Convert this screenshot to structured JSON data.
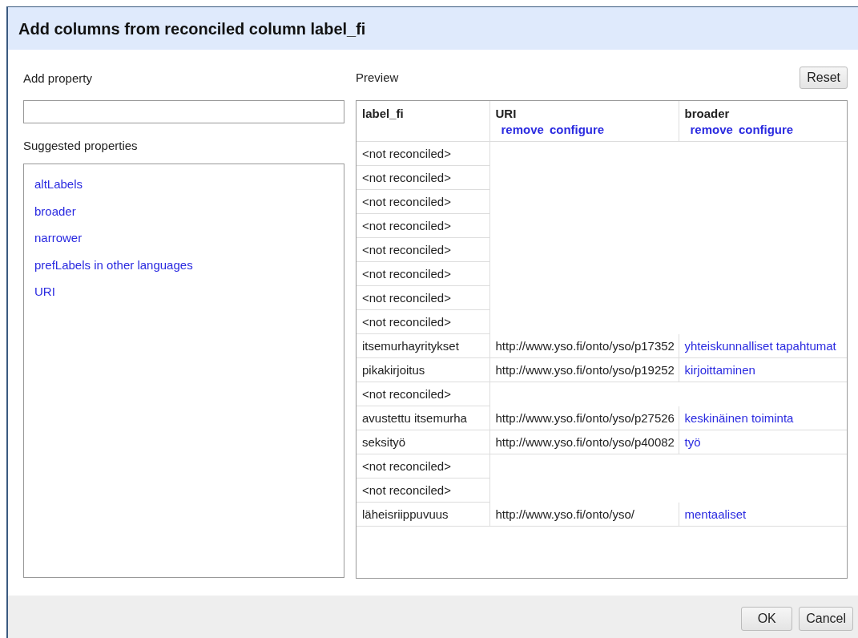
{
  "dialog": {
    "title": "Add columns from reconciled column label_fi"
  },
  "add_property": {
    "label": "Add property"
  },
  "suggested": {
    "label": "Suggested properties",
    "items": [
      "altLabels",
      "broader",
      "narrower",
      "prefLabels in other languages",
      "URI"
    ]
  },
  "preview": {
    "label": "Preview",
    "reset": "Reset",
    "columns": [
      {
        "name": "label_fi"
      },
      {
        "name": "URI",
        "actions": [
          "remove",
          "configure"
        ]
      },
      {
        "name": "broader",
        "actions": [
          "remove",
          "configure"
        ]
      }
    ],
    "rows": [
      {
        "label": "<not reconciled>"
      },
      {
        "label": "<not reconciled>"
      },
      {
        "label": "<not reconciled>"
      },
      {
        "label": "<not reconciled>"
      },
      {
        "label": "<not reconciled>"
      },
      {
        "label": "<not reconciled>"
      },
      {
        "label": "<not reconciled>"
      },
      {
        "label": "<not reconciled>"
      },
      {
        "label": "itsemurhayritykset",
        "uri": "http://www.yso.fi/onto/yso/p17352",
        "broader": "yhteiskunnalliset tapahtumat"
      },
      {
        "label": "pikakirjoitus",
        "uri": "http://www.yso.fi/onto/yso/p19252",
        "broader": "kirjoittaminen"
      },
      {
        "label": "<not reconciled>"
      },
      {
        "label": "avustettu itsemurha",
        "uri": "http://www.yso.fi/onto/yso/p27526",
        "broader": "keskinäinen toiminta"
      },
      {
        "label": "seksityö",
        "uri": "http://www.yso.fi/onto/yso/p40082",
        "broader": "työ"
      },
      {
        "label": "<not reconciled>"
      },
      {
        "label": "<not reconciled>"
      },
      {
        "label": "läheisriippuvuus",
        "uri": "http://www.yso.fi/onto/yso/",
        "broader": "mentaaliset"
      }
    ]
  },
  "buttons": [
    "OK",
    "Cancel"
  ]
}
